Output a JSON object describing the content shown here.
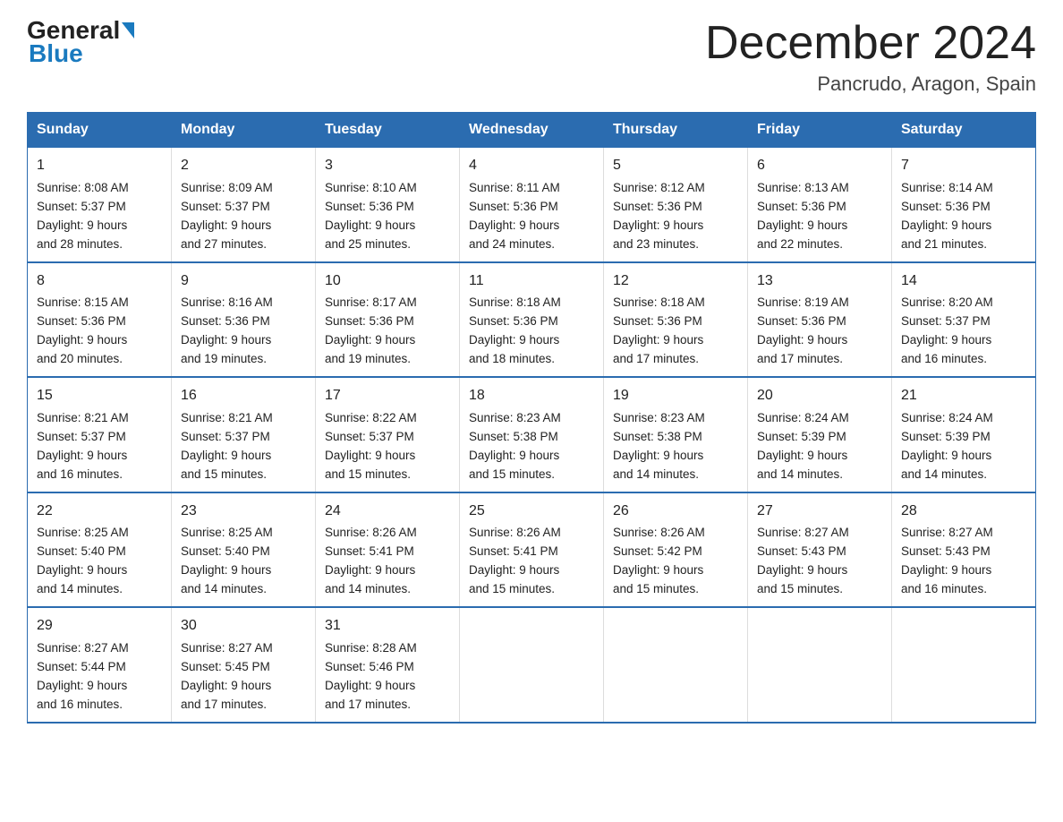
{
  "header": {
    "logo_top": "General",
    "logo_bottom": "Blue",
    "month": "December 2024",
    "location": "Pancrudo, Aragon, Spain"
  },
  "days_of_week": [
    "Sunday",
    "Monday",
    "Tuesday",
    "Wednesday",
    "Thursday",
    "Friday",
    "Saturday"
  ],
  "weeks": [
    [
      {
        "day": "1",
        "sunrise": "8:08 AM",
        "sunset": "5:37 PM",
        "daylight": "9 hours and 28 minutes."
      },
      {
        "day": "2",
        "sunrise": "8:09 AM",
        "sunset": "5:37 PM",
        "daylight": "9 hours and 27 minutes."
      },
      {
        "day": "3",
        "sunrise": "8:10 AM",
        "sunset": "5:36 PM",
        "daylight": "9 hours and 25 minutes."
      },
      {
        "day": "4",
        "sunrise": "8:11 AM",
        "sunset": "5:36 PM",
        "daylight": "9 hours and 24 minutes."
      },
      {
        "day": "5",
        "sunrise": "8:12 AM",
        "sunset": "5:36 PM",
        "daylight": "9 hours and 23 minutes."
      },
      {
        "day": "6",
        "sunrise": "8:13 AM",
        "sunset": "5:36 PM",
        "daylight": "9 hours and 22 minutes."
      },
      {
        "day": "7",
        "sunrise": "8:14 AM",
        "sunset": "5:36 PM",
        "daylight": "9 hours and 21 minutes."
      }
    ],
    [
      {
        "day": "8",
        "sunrise": "8:15 AM",
        "sunset": "5:36 PM",
        "daylight": "9 hours and 20 minutes."
      },
      {
        "day": "9",
        "sunrise": "8:16 AM",
        "sunset": "5:36 PM",
        "daylight": "9 hours and 19 minutes."
      },
      {
        "day": "10",
        "sunrise": "8:17 AM",
        "sunset": "5:36 PM",
        "daylight": "9 hours and 19 minutes."
      },
      {
        "day": "11",
        "sunrise": "8:18 AM",
        "sunset": "5:36 PM",
        "daylight": "9 hours and 18 minutes."
      },
      {
        "day": "12",
        "sunrise": "8:18 AM",
        "sunset": "5:36 PM",
        "daylight": "9 hours and 17 minutes."
      },
      {
        "day": "13",
        "sunrise": "8:19 AM",
        "sunset": "5:36 PM",
        "daylight": "9 hours and 17 minutes."
      },
      {
        "day": "14",
        "sunrise": "8:20 AM",
        "sunset": "5:37 PM",
        "daylight": "9 hours and 16 minutes."
      }
    ],
    [
      {
        "day": "15",
        "sunrise": "8:21 AM",
        "sunset": "5:37 PM",
        "daylight": "9 hours and 16 minutes."
      },
      {
        "day": "16",
        "sunrise": "8:21 AM",
        "sunset": "5:37 PM",
        "daylight": "9 hours and 15 minutes."
      },
      {
        "day": "17",
        "sunrise": "8:22 AM",
        "sunset": "5:37 PM",
        "daylight": "9 hours and 15 minutes."
      },
      {
        "day": "18",
        "sunrise": "8:23 AM",
        "sunset": "5:38 PM",
        "daylight": "9 hours and 15 minutes."
      },
      {
        "day": "19",
        "sunrise": "8:23 AM",
        "sunset": "5:38 PM",
        "daylight": "9 hours and 14 minutes."
      },
      {
        "day": "20",
        "sunrise": "8:24 AM",
        "sunset": "5:39 PM",
        "daylight": "9 hours and 14 minutes."
      },
      {
        "day": "21",
        "sunrise": "8:24 AM",
        "sunset": "5:39 PM",
        "daylight": "9 hours and 14 minutes."
      }
    ],
    [
      {
        "day": "22",
        "sunrise": "8:25 AM",
        "sunset": "5:40 PM",
        "daylight": "9 hours and 14 minutes."
      },
      {
        "day": "23",
        "sunrise": "8:25 AM",
        "sunset": "5:40 PM",
        "daylight": "9 hours and 14 minutes."
      },
      {
        "day": "24",
        "sunrise": "8:26 AM",
        "sunset": "5:41 PM",
        "daylight": "9 hours and 14 minutes."
      },
      {
        "day": "25",
        "sunrise": "8:26 AM",
        "sunset": "5:41 PM",
        "daylight": "9 hours and 15 minutes."
      },
      {
        "day": "26",
        "sunrise": "8:26 AM",
        "sunset": "5:42 PM",
        "daylight": "9 hours and 15 minutes."
      },
      {
        "day": "27",
        "sunrise": "8:27 AM",
        "sunset": "5:43 PM",
        "daylight": "9 hours and 15 minutes."
      },
      {
        "day": "28",
        "sunrise": "8:27 AM",
        "sunset": "5:43 PM",
        "daylight": "9 hours and 16 minutes."
      }
    ],
    [
      {
        "day": "29",
        "sunrise": "8:27 AM",
        "sunset": "5:44 PM",
        "daylight": "9 hours and 16 minutes."
      },
      {
        "day": "30",
        "sunrise": "8:27 AM",
        "sunset": "5:45 PM",
        "daylight": "9 hours and 17 minutes."
      },
      {
        "day": "31",
        "sunrise": "8:28 AM",
        "sunset": "5:46 PM",
        "daylight": "9 hours and 17 minutes."
      },
      null,
      null,
      null,
      null
    ]
  ],
  "labels": {
    "sunrise": "Sunrise:",
    "sunset": "Sunset:",
    "daylight": "Daylight:"
  }
}
